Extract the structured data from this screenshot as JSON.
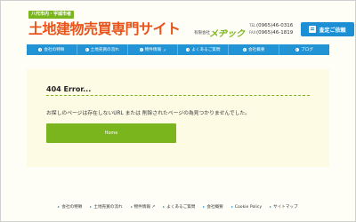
{
  "header": {
    "tagline": "八代市内・宇城市者",
    "logo": "土地建物売買専門サイト",
    "company_prefix": "有限会社",
    "company_name": "メヂック",
    "phones": [
      {
        "tag": "TEL",
        "number": "(0965)46-0316"
      },
      {
        "tag": "FAX",
        "number": "(0965)46-1819"
      }
    ],
    "assess_button": "査定ご依頼"
  },
  "nav": {
    "items": [
      {
        "label": "会社の特徴",
        "icon": "arrow-circle-icon"
      },
      {
        "label": "土地売買の流れ",
        "icon": "arrow-circle-icon"
      },
      {
        "label": "物件情報",
        "icon": "arrow-circle-icon",
        "ext": "↗"
      },
      {
        "label": "よくあるご質問",
        "icon": "arrow-circle-icon"
      },
      {
        "label": "会社概要",
        "icon": "arrow-circle-icon"
      },
      {
        "label": "ブログ",
        "icon": "arrow-circle-icon"
      }
    ]
  },
  "main": {
    "title": "404 Error...",
    "message": "お探しのページは存在しないURL または 削除されたページの為見つかりませんでした。",
    "home_button": "Home"
  },
  "footer": {
    "links": [
      "会社の特徴",
      "土地売買の流れ",
      "物件情報 ↗",
      "よくあるご質問",
      "会社概要",
      "Cookie Policy",
      "サイトマップ"
    ]
  },
  "colors": {
    "brand_orange": "#e8551c",
    "nav_blue": "#2294d6",
    "accent_green": "#7ab51d"
  }
}
